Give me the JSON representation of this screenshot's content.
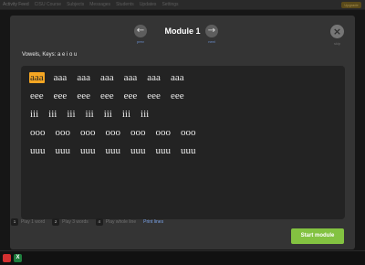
{
  "background_nav": {
    "items": [
      "Activity Feed",
      "CISU Course",
      "Subjects",
      "Messages",
      "Students",
      "Updates",
      "Settings"
    ],
    "badge": "Upgrade"
  },
  "modal": {
    "title": "Module 1",
    "prev_label": "prev",
    "next_label": "next",
    "close_label": "skip",
    "subtitle": "Vowels, Keys: a e i o u",
    "lines": [
      [
        "aaa",
        "aaa",
        "aaa",
        "aaa",
        "aaa",
        "aaa",
        "aaa"
      ],
      [
        "eee",
        "eee",
        "eee",
        "eee",
        "eee",
        "eee",
        "eee"
      ],
      [
        "iii",
        "iii",
        "iii",
        "iii",
        "iii",
        "iii",
        "iii"
      ],
      [
        "ooo",
        "ooo",
        "ooo",
        "ooo",
        "ooo",
        "ooo",
        "ooo"
      ],
      [
        "uuu",
        "uuu",
        "uuu",
        "uuu",
        "uuu",
        "uuu",
        "uuu"
      ]
    ],
    "footer": {
      "options": [
        {
          "key": "1",
          "label": "Play 1 word"
        },
        {
          "key": "2",
          "label": "Play 3 words"
        },
        {
          "key": "4",
          "label": "Play whole line"
        }
      ],
      "print_label": "Print lines",
      "start_label": "Start module"
    }
  },
  "colors": {
    "accent_highlight": "#f5a623",
    "start_button": "#83c241",
    "link": "#7aa2e8"
  },
  "taskbar": {
    "icons": [
      "red-app-icon",
      "excel-icon"
    ],
    "excel_glyph": "X"
  }
}
